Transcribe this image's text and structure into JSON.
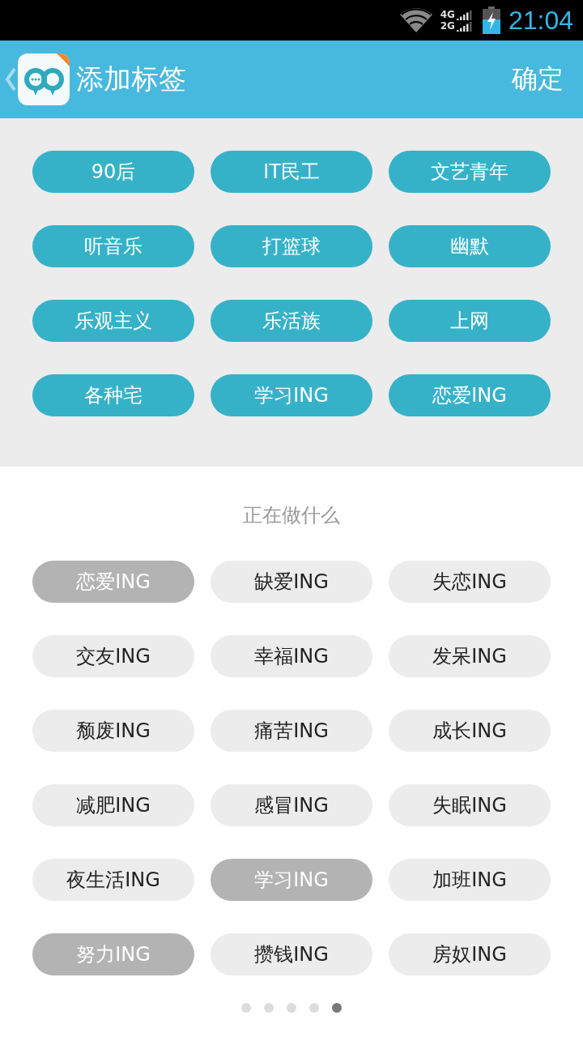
{
  "status_bar": {
    "network_top": "4G",
    "network_bottom": "2G",
    "time": "21:04"
  },
  "header": {
    "title": "添加标签",
    "confirm": "确定"
  },
  "my_tags": [
    "90后",
    "IT民工",
    "文艺青年",
    "听音乐",
    "打篮球",
    "幽默",
    "乐观主义",
    "乐活族",
    "上网",
    "各种宅",
    "学习ING",
    "恋爱ING"
  ],
  "section": {
    "title": "正在做什么",
    "tags": [
      {
        "label": "恋爱ING",
        "selected": true
      },
      {
        "label": "缺爱ING",
        "selected": false
      },
      {
        "label": "失恋ING",
        "selected": false
      },
      {
        "label": "交友ING",
        "selected": false
      },
      {
        "label": "幸福ING",
        "selected": false
      },
      {
        "label": "发呆ING",
        "selected": false
      },
      {
        "label": "颓废ING",
        "selected": false
      },
      {
        "label": "痛苦ING",
        "selected": false
      },
      {
        "label": "成长ING",
        "selected": false
      },
      {
        "label": "减肥ING",
        "selected": false
      },
      {
        "label": "感冒ING",
        "selected": false
      },
      {
        "label": "失眠ING",
        "selected": false
      },
      {
        "label": "夜生活ING",
        "selected": false
      },
      {
        "label": "学习ING",
        "selected": true
      },
      {
        "label": "加班ING",
        "selected": false
      },
      {
        "label": "努力ING",
        "selected": true
      },
      {
        "label": "攒钱ING",
        "selected": false
      },
      {
        "label": "房奴ING",
        "selected": false
      }
    ]
  },
  "pager": [
    {
      "selected": false
    },
    {
      "selected": false
    },
    {
      "selected": false
    },
    {
      "selected": false
    },
    {
      "selected": true
    }
  ]
}
